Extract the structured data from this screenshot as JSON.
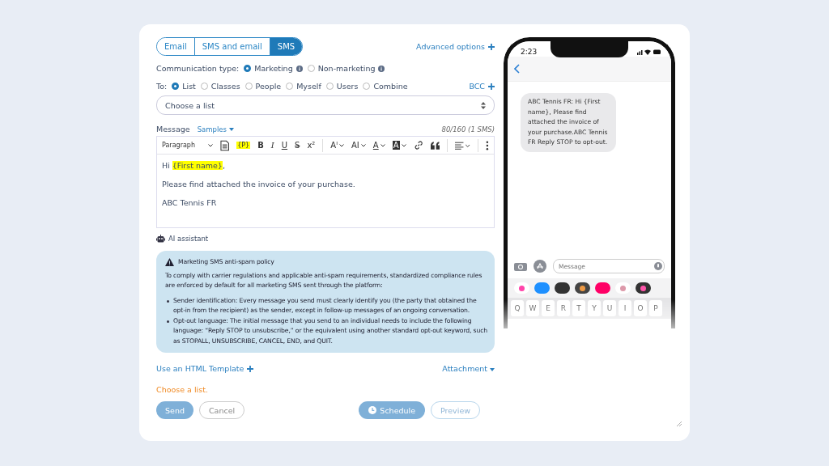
{
  "channel_tabs": [
    {
      "label": "Email",
      "selected": false
    },
    {
      "label": "SMS and email",
      "selected": false
    },
    {
      "label": "SMS",
      "selected": true
    }
  ],
  "advanced_options": "Advanced options",
  "communication_type": {
    "label": "Communication type:",
    "options": [
      {
        "label": "Marketing",
        "selected": true
      },
      {
        "label": "Non-marketing",
        "selected": false
      }
    ]
  },
  "to": {
    "label": "To:",
    "options": [
      {
        "label": "List",
        "selected": true
      },
      {
        "label": "Classes",
        "selected": false
      },
      {
        "label": "People",
        "selected": false
      },
      {
        "label": "Myself",
        "selected": false
      },
      {
        "label": "Users",
        "selected": false
      },
      {
        "label": "Combine",
        "selected": false
      }
    ]
  },
  "bcc": "BCC",
  "list_select": {
    "placeholder": "Choose a list"
  },
  "message": {
    "label": "Message",
    "samples": "Samples",
    "counter": "80/160 (1 SMS)"
  },
  "toolbar": [
    {
      "kind": "select",
      "label": "Paragraph"
    },
    {
      "kind": "doc"
    },
    {
      "kind": "tag",
      "label": "{P}"
    },
    {
      "kind": "bold",
      "label": "B"
    },
    {
      "kind": "italic",
      "label": "I"
    },
    {
      "kind": "underline",
      "label": "U"
    },
    {
      "kind": "strike",
      "label": "S"
    },
    {
      "kind": "text",
      "label": "x²"
    },
    {
      "kind": "divider"
    },
    {
      "kind": "caret",
      "label": "Aᴵ"
    },
    {
      "kind": "caret",
      "label": "AI"
    },
    {
      "kind": "underline-caret",
      "label": "A"
    },
    {
      "kind": "inverse-caret",
      "label": "A"
    },
    {
      "kind": "link"
    },
    {
      "kind": "quote"
    },
    {
      "kind": "divider"
    },
    {
      "kind": "align"
    },
    {
      "kind": "divider"
    },
    {
      "kind": "more"
    }
  ],
  "body": {
    "greeting": "Hi",
    "variable": "{First name}",
    "punct": ",",
    "lines": [
      "Please find attached the invoice of your purchase.",
      "ABC Tennis FR"
    ]
  },
  "ai_assistant": "AI assistant",
  "policy": {
    "title": "Marketing SMS anti-spam policy",
    "intro": "To comply with carrier regulations and applicable anti-spam requirements, standardized compliance rules are enforced by default for all marketing SMS sent through the platform:",
    "items": [
      "Sender identification: Every message you send must clearly identify you (the party that obtained the opt-in from the recipient) as the sender, except in follow-up messages of an ongoing conversation.",
      "Opt-out language: The initial message that you send to an individual needs to include the following language: “Reply STOP to unsubscribe,” or the equivalent using another standard opt-out keyword, such as STOPALL, UNSUBSCRIBE, CANCEL, END, and QUIT."
    ]
  },
  "html_template": "Use an HTML Template",
  "attachment": "Attachment",
  "error": "Choose a list.",
  "buttons": {
    "send": "Send",
    "cancel": "Cancel",
    "schedule": "Schedule",
    "preview": "Preview"
  },
  "phone": {
    "time": "2:23",
    "bubble": "ABC Tennis FR: Hi {First name}, Please find attached the invoice of your purchase.ABC Tennis FR Reply STOP to opt-out.",
    "input_placeholder": "Message",
    "keys": [
      "Q",
      "W",
      "E",
      "R",
      "T",
      "Y",
      "U",
      "I",
      "O",
      "P"
    ]
  }
}
